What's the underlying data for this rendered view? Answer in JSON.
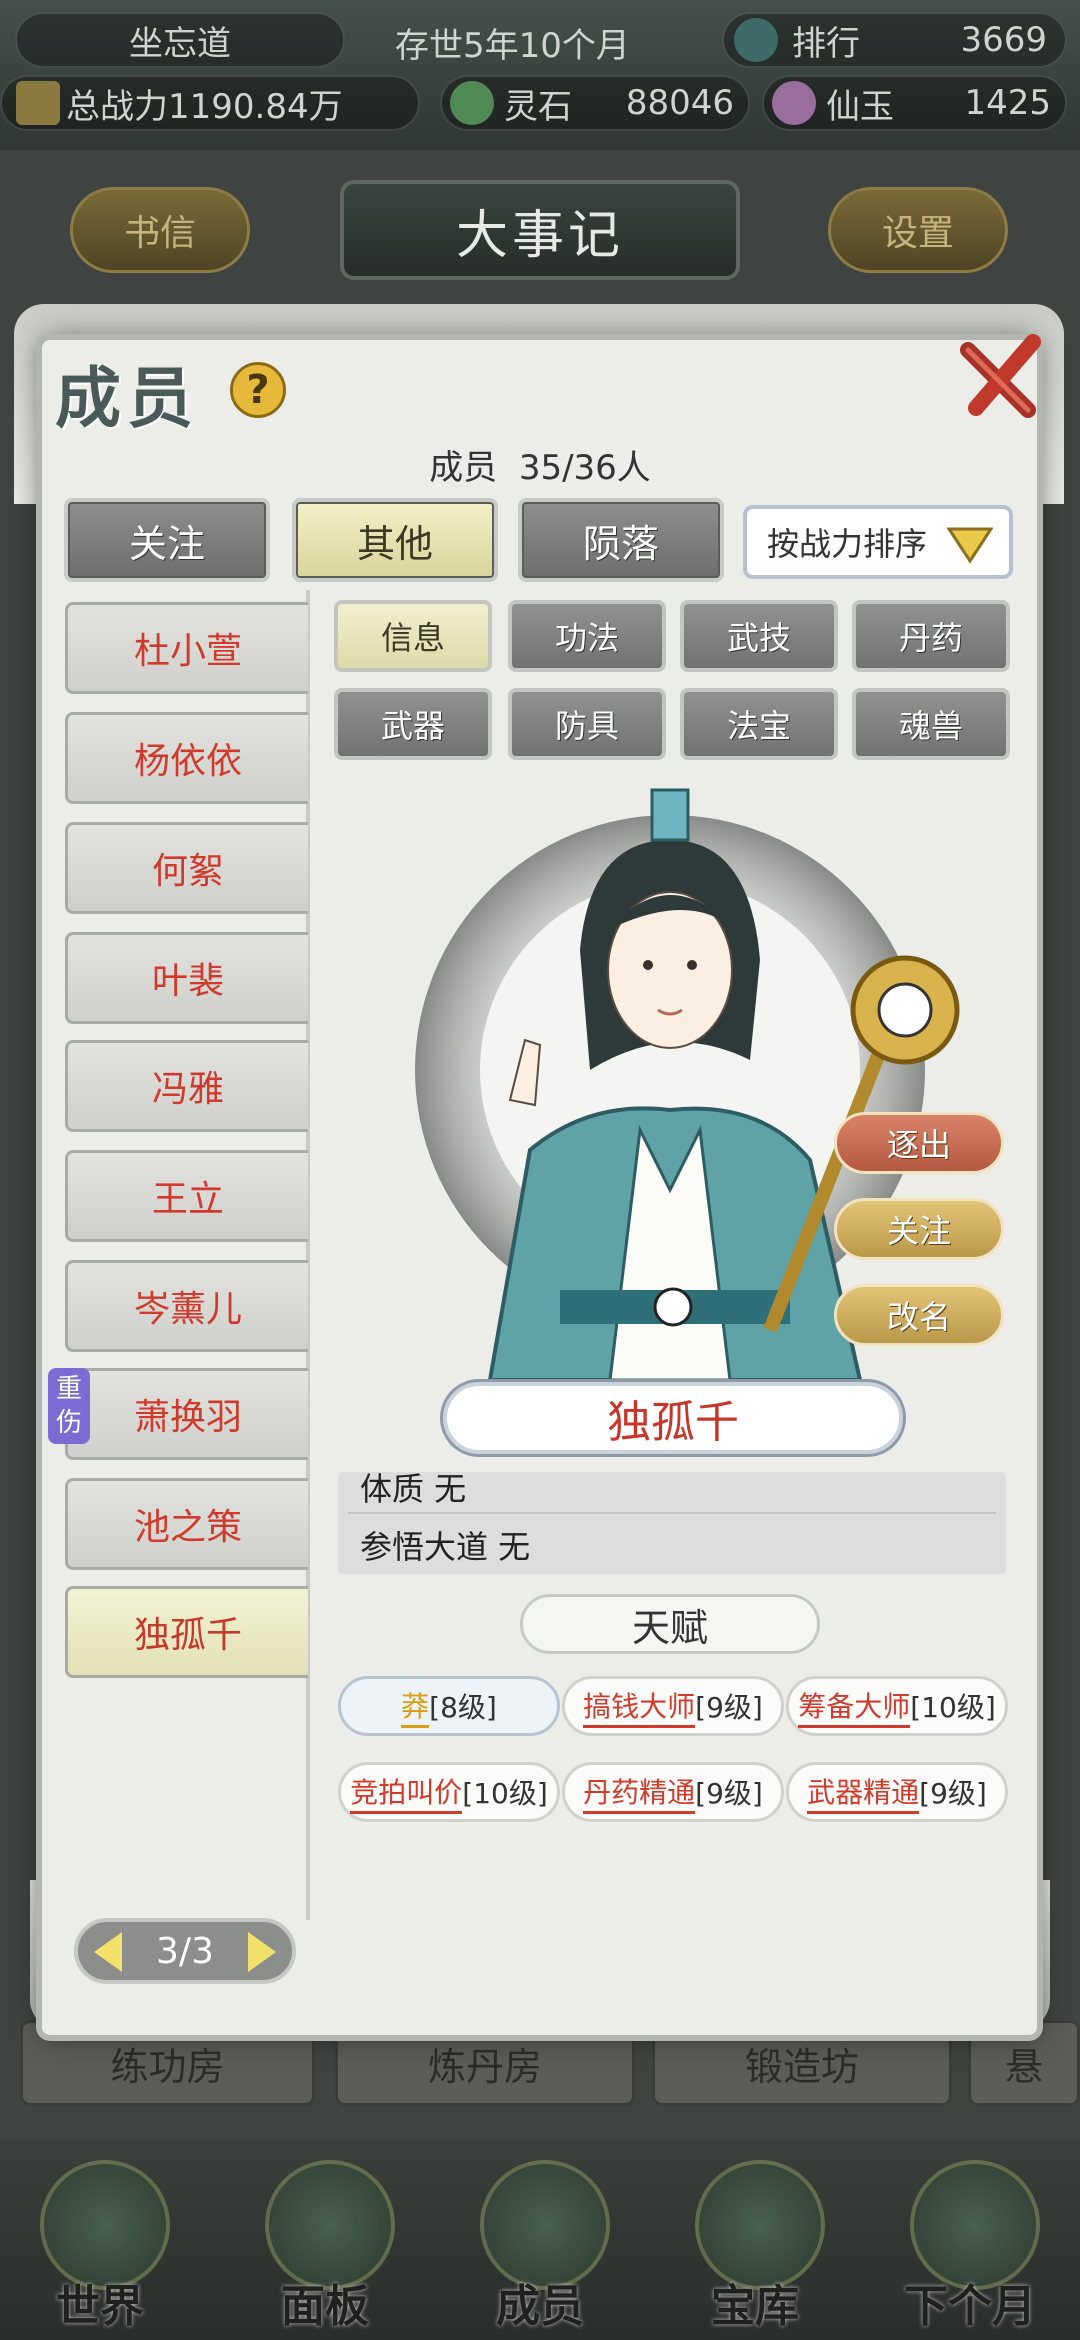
{
  "topbar": {
    "sect_name": "坐忘道",
    "time": "存世5年10个月",
    "ranking_label": "排行",
    "ranking_value": "3669",
    "power_label": "总战力1190.84万",
    "spirit_stone_label": "灵石",
    "spirit_stone_value": "88046",
    "jade_label": "仙玉",
    "jade_value": "1425"
  },
  "background": {
    "left_button": "书信",
    "title": "大事记",
    "right_button": "设置",
    "rooms": [
      "练功房",
      "炼丹房",
      "锻造坊",
      "悬"
    ]
  },
  "bottom_nav": [
    "世界",
    "面板",
    "成员",
    "宝库",
    "下个月"
  ],
  "modal": {
    "title": "成员",
    "help_icon": "?",
    "count_label": "成员",
    "count_value": "35/36人",
    "tabs": [
      "关注",
      "其他",
      "陨落"
    ],
    "sort_label": "按战力排序",
    "members": [
      "杜小萱",
      "杨依依",
      "何絮",
      "叶裴",
      "冯雅",
      "王立",
      "岑薰儿",
      "萧换羽",
      "池之策",
      "独孤千"
    ],
    "injury_badge": "重伤",
    "sub_tabs": [
      "信息",
      "功法",
      "武技",
      "丹药",
      "武器",
      "防具",
      "法宝",
      "魂兽"
    ],
    "side_actions": [
      "逐出",
      "关注",
      "改名"
    ],
    "selected_name": "独孤千",
    "attributes": [
      "体质 无",
      "参悟大道 无"
    ],
    "talent_header": "天赋",
    "talents": [
      {
        "name": "莽",
        "level": "[8级]"
      },
      {
        "name": "搞钱大师",
        "level": "[9级]"
      },
      {
        "name": "筹备大师",
        "level": "[10级]"
      },
      {
        "name": "竞拍叫价",
        "level": "[10级]"
      },
      {
        "name": "丹药精通",
        "level": "[9级]"
      },
      {
        "name": "武器精通",
        "level": "[9级]"
      }
    ],
    "pager": "3/3"
  },
  "colors": {
    "accent_red": "#d03a2c",
    "active_tab": "#e6e2b0",
    "inactive_tab": "#7d807d",
    "expel_button": "#c0604a",
    "gold_button": "#c9a24a"
  }
}
